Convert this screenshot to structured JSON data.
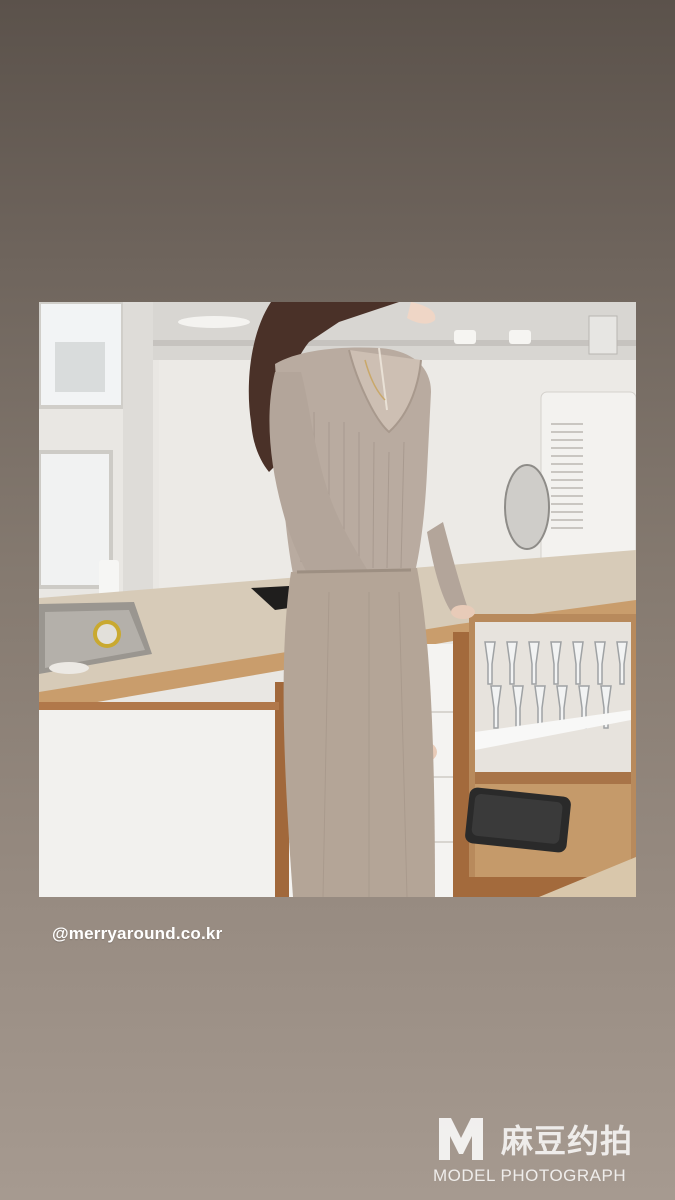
{
  "story": {
    "photo_alt": "Woman in beige ribbed wrap sweater and knit skirt standing in a white kitchen",
    "username": "@merryaround.co.kr"
  },
  "watermark": {
    "logo_letter": "M",
    "brand_cn": "麻豆约拍",
    "brand_en": "MODEL PHOTOGRAPH"
  },
  "colors": {
    "background_top": "#5b524b",
    "background_bottom": "#a69a90",
    "text": "#ffffff"
  }
}
